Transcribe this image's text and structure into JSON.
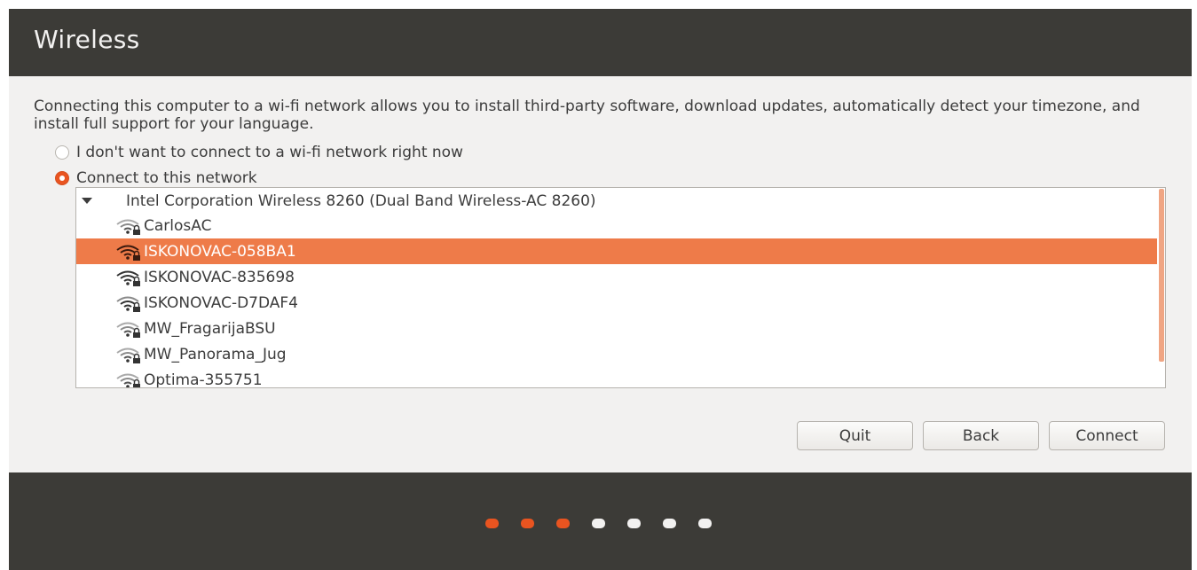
{
  "header": {
    "title": "Wireless"
  },
  "description": "Connecting this computer to a wi-fi network allows you to install third-party software, download updates, automatically detect your timezone, and install full support for your language.",
  "options": {
    "no_wifi": {
      "label": "I don't want to connect to a wi-fi network right now",
      "selected": false
    },
    "connect": {
      "label": "Connect to this network",
      "selected": true
    }
  },
  "network_list": {
    "device": "Intel Corporation Wireless 8260 (Dual Band Wireless-AC 8260)",
    "access_points": [
      {
        "name": "CarlosAC",
        "icon": "wifi-locked-icon",
        "selected": false
      },
      {
        "name": "ISKONOVAC-058BA1",
        "icon": "wifi-locked-icon",
        "selected": true
      },
      {
        "name": "ISKONOVAC-835698",
        "icon": "wifi-locked-icon",
        "selected": false
      },
      {
        "name": "ISKONOVAC-D7DAF4",
        "icon": "wifi-locked-icon",
        "selected": false
      },
      {
        "name": "MW_FragarijaBSU",
        "icon": "wifi-locked-icon",
        "selected": false
      },
      {
        "name": "MW_Panorama_Jug",
        "icon": "wifi-locked-icon",
        "selected": false
      },
      {
        "name": "Optima-355751",
        "icon": "wifi-locked-icon",
        "selected": false
      }
    ]
  },
  "buttons": {
    "quit": "Quit",
    "back": "Back",
    "connect": "Connect"
  },
  "progress": {
    "total_steps": 7,
    "completed_steps": 3
  },
  "colors": {
    "accent": "#e95420",
    "selection": "#ee7b49",
    "header_bg": "#3c3b37",
    "content_bg": "#f2f1f0"
  }
}
